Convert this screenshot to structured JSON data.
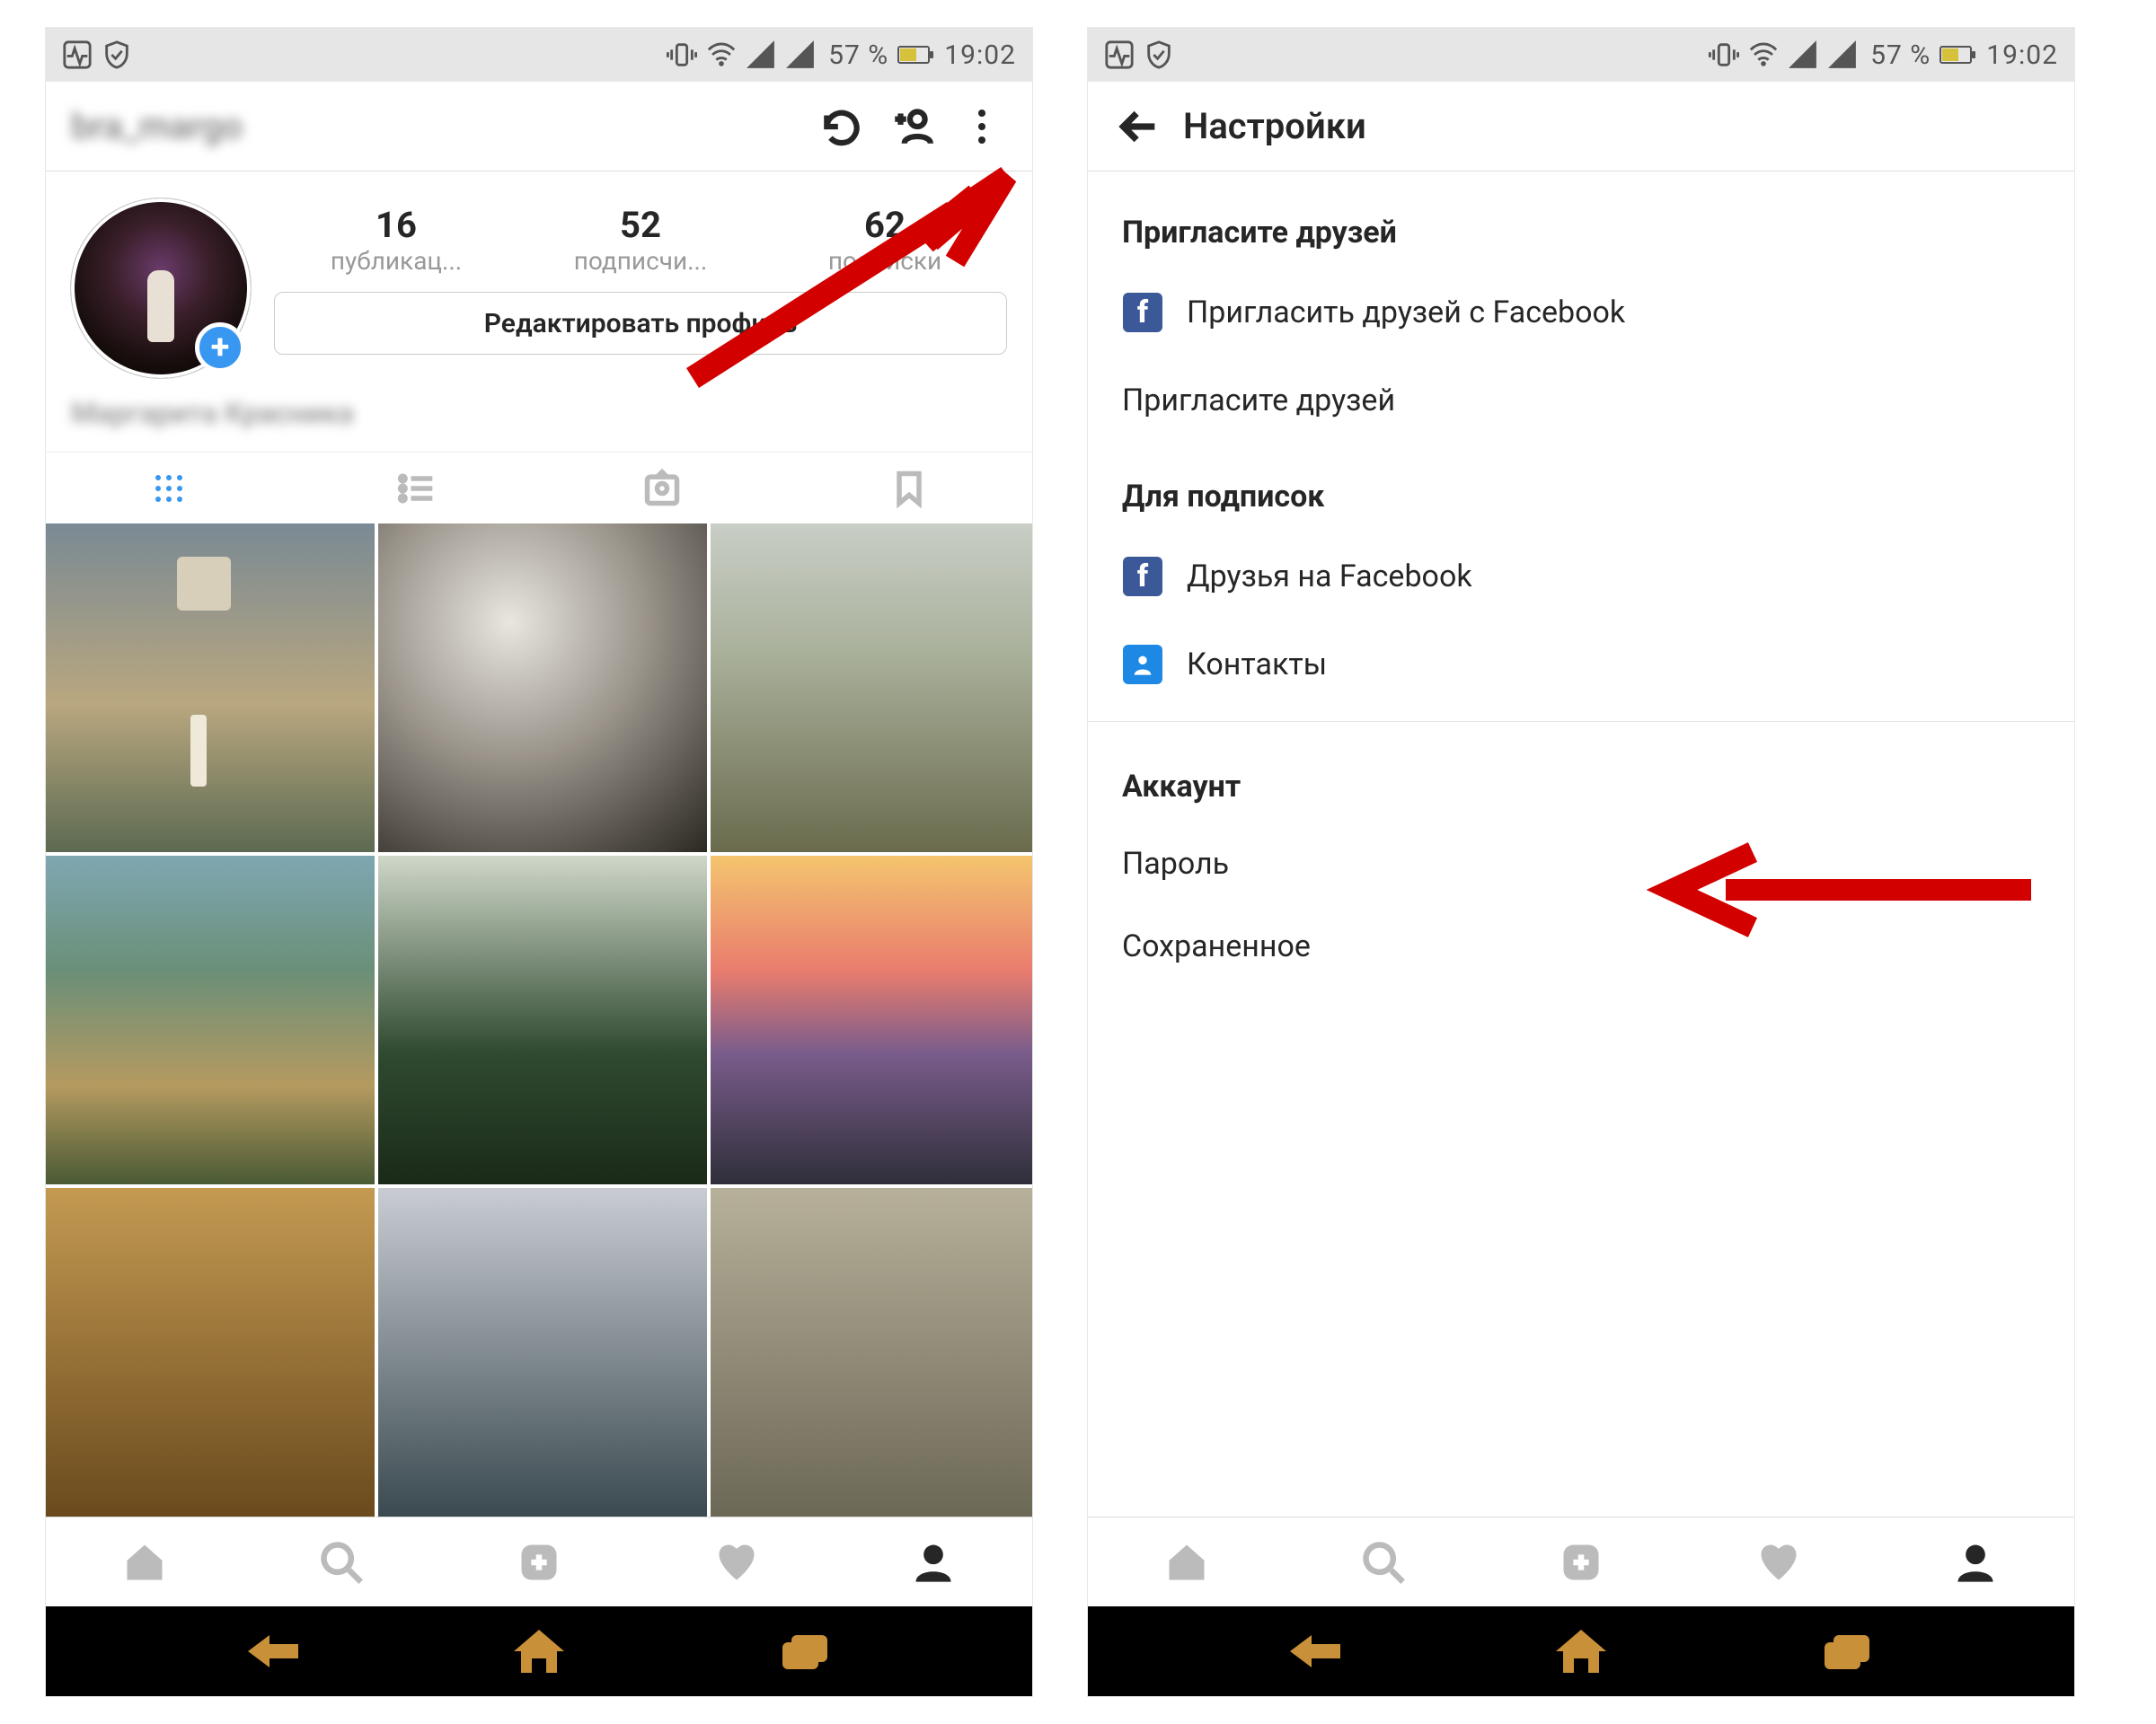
{
  "status": {
    "battery_pct": "57 %",
    "time": "19:02"
  },
  "profile": {
    "username_blurred": "bra_margo",
    "stats": {
      "posts": {
        "count": "16",
        "label": "публикац..."
      },
      "followers": {
        "count": "52",
        "label": "подписчи..."
      },
      "following": {
        "count": "62",
        "label": "подписки"
      }
    },
    "edit_button": "Редактировать профиль",
    "display_name_blurred": "Маргарита Красника"
  },
  "settings": {
    "title": "Настройки",
    "section_invite": "Пригласите друзей",
    "rows_invite": [
      {
        "icon": "facebook",
        "label": "Пригласить друзей с Facebook"
      },
      {
        "icon": "none",
        "label": "Пригласите друзей"
      }
    ],
    "section_follow": "Для подписок",
    "rows_follow": [
      {
        "icon": "facebook",
        "label": "Друзья на Facebook"
      },
      {
        "icon": "contacts",
        "label": "Контакты"
      }
    ],
    "section_account": "Аккаунт",
    "rows_account": [
      {
        "label": "Пароль"
      },
      {
        "label": "Сохраненное"
      }
    ]
  }
}
